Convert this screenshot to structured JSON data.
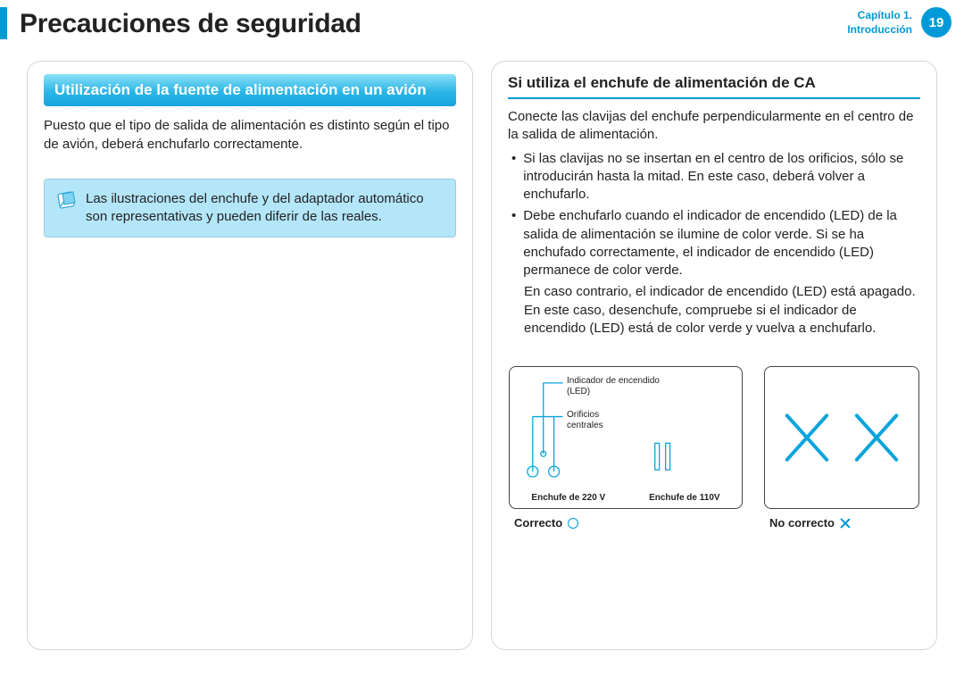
{
  "header": {
    "title": "Precauciones de seguridad",
    "chapter_line1": "Capítulo 1.",
    "chapter_line2": "Introducción",
    "page_number": "19"
  },
  "left": {
    "section_title": "Utilización de la fuente de alimentación en un avión",
    "para1": "Puesto que el tipo de salida de alimentación es distinto según el tipo de avión, deberá enchufarlo correctamente.",
    "note": "Las ilustraciones del enchufe y del adaptador automático son representativas y pueden diferir de las reales."
  },
  "right": {
    "section_title": "Si utiliza el enchufe de alimentación de CA",
    "para1": "Conecte las clavijas del enchufe perpendicularmente en el centro de la salida de alimentación.",
    "bullet1": "Si las clavijas no se insertan en el centro de los orificios, sólo se introducirán hasta la mitad. En este caso, deberá volver a enchufarlo.",
    "bullet2": "Debe enchufarlo cuando el indicador de encendido (LED) de la salida de alimentación se ilumine de color verde. Si se ha enchufado correctamente, el indicador de encendido (LED) permanece de color verde.",
    "para2": "En caso contrario, el indicador de encendido (LED) está apagado. En este caso, desenchufe, compruebe si el indicador de encendido (LED) está de color verde y vuelva a enchufarlo.",
    "fig": {
      "led_label": "Indicador de encendido (LED)",
      "holes_label": "Orificios centrales",
      "plug220": "Enchufe de 220 V",
      "plug110": "Enchufe de 110V"
    },
    "verdict_ok": "Correcto",
    "verdict_bad": "No correcto"
  }
}
